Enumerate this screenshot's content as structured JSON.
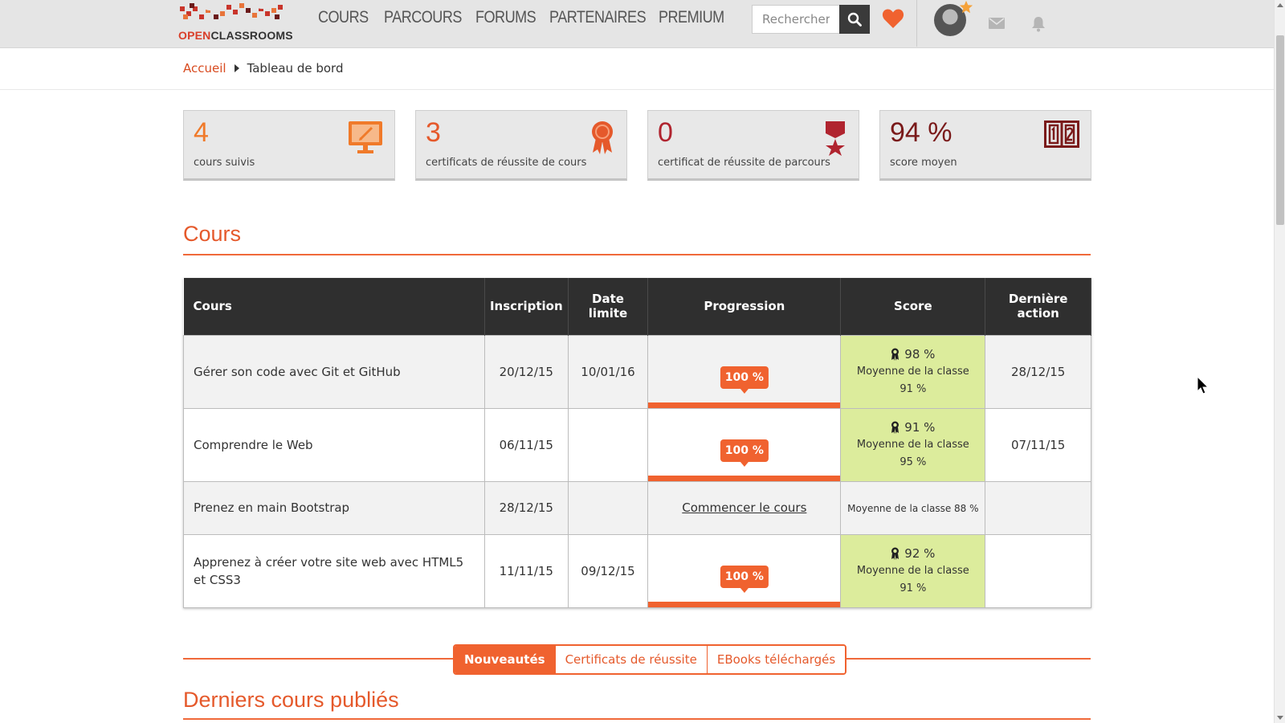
{
  "brand": {
    "logo_prefix": "OPEN",
    "logo_suffix": "CLASSROOMS",
    "accent": "#f0622f"
  },
  "nav": {
    "items": [
      {
        "label": "COURS"
      },
      {
        "label": "PARCOURS"
      },
      {
        "label": "FORUMS"
      },
      {
        "label": "PARTENAIRES"
      },
      {
        "label": "PREMIUM"
      }
    ],
    "search_placeholder": "Rechercher",
    "icons": [
      "search-icon",
      "heart-icon",
      "avatar",
      "star-icon",
      "mail-icon",
      "bell-icon"
    ]
  },
  "breadcrumb": {
    "home": "Accueil",
    "current": "Tableau de bord"
  },
  "stats": [
    {
      "value": "4",
      "label": "cours suivis",
      "icon": "monitor-icon",
      "color": "#f07a2a"
    },
    {
      "value": "3",
      "label": "certificats de réussite de cours",
      "icon": "ribbon-badge-icon",
      "color": "#e5592b"
    },
    {
      "value": "0",
      "label": "certificat de réussite de parcours",
      "icon": "medal-star-icon",
      "color": "#b0242f"
    },
    {
      "value": "94 %",
      "label": "score moyen",
      "icon": "scoreboard-icon",
      "color": "#7a1a1a"
    }
  ],
  "courses_section": {
    "title": "Cours",
    "headers": {
      "course": "Cours",
      "inscription": "Inscription",
      "deadline_1": "Date",
      "deadline_2": "limite",
      "progress": "Progression",
      "score": "Score",
      "last_1": "Dernière",
      "last_2": "action"
    },
    "rows": [
      {
        "name": "Gérer son code avec Git et GitHub",
        "inscription": "20/12/15",
        "deadline": "10/01/16",
        "progress": "100 %",
        "progress_pct": 100,
        "score": "98 %",
        "avg_label": "Moyenne de la classe",
        "avg": "91 %",
        "last_action": "28/12/15"
      },
      {
        "name": "Comprendre le Web",
        "inscription": "06/11/15",
        "deadline": "",
        "progress": "100 %",
        "progress_pct": 100,
        "score": "91 %",
        "avg_label": "Moyenne de la classe",
        "avg": "95 %",
        "last_action": "07/11/15"
      },
      {
        "name": "Prenez en main Bootstrap",
        "inscription": "28/12/15",
        "deadline": "",
        "start_link": "Commencer le cours",
        "avg_inline": "Moyenne de la classe 88 %",
        "last_action": ""
      },
      {
        "name": "Apprenez à créer votre site web avec HTML5 et CSS3",
        "inscription": "11/11/15",
        "deadline": "09/12/15",
        "progress": "100 %",
        "progress_pct": 100,
        "score": "92 %",
        "avg_label": "Moyenne de la classe",
        "avg": "91 %",
        "last_action": ""
      }
    ]
  },
  "tabs": {
    "items": [
      {
        "label": "Nouveautés",
        "active": true
      },
      {
        "label": "Certificats de réussite",
        "active": false
      },
      {
        "label": "EBooks téléchargés",
        "active": false
      }
    ]
  },
  "latest_section": {
    "title": "Derniers cours publiés"
  }
}
